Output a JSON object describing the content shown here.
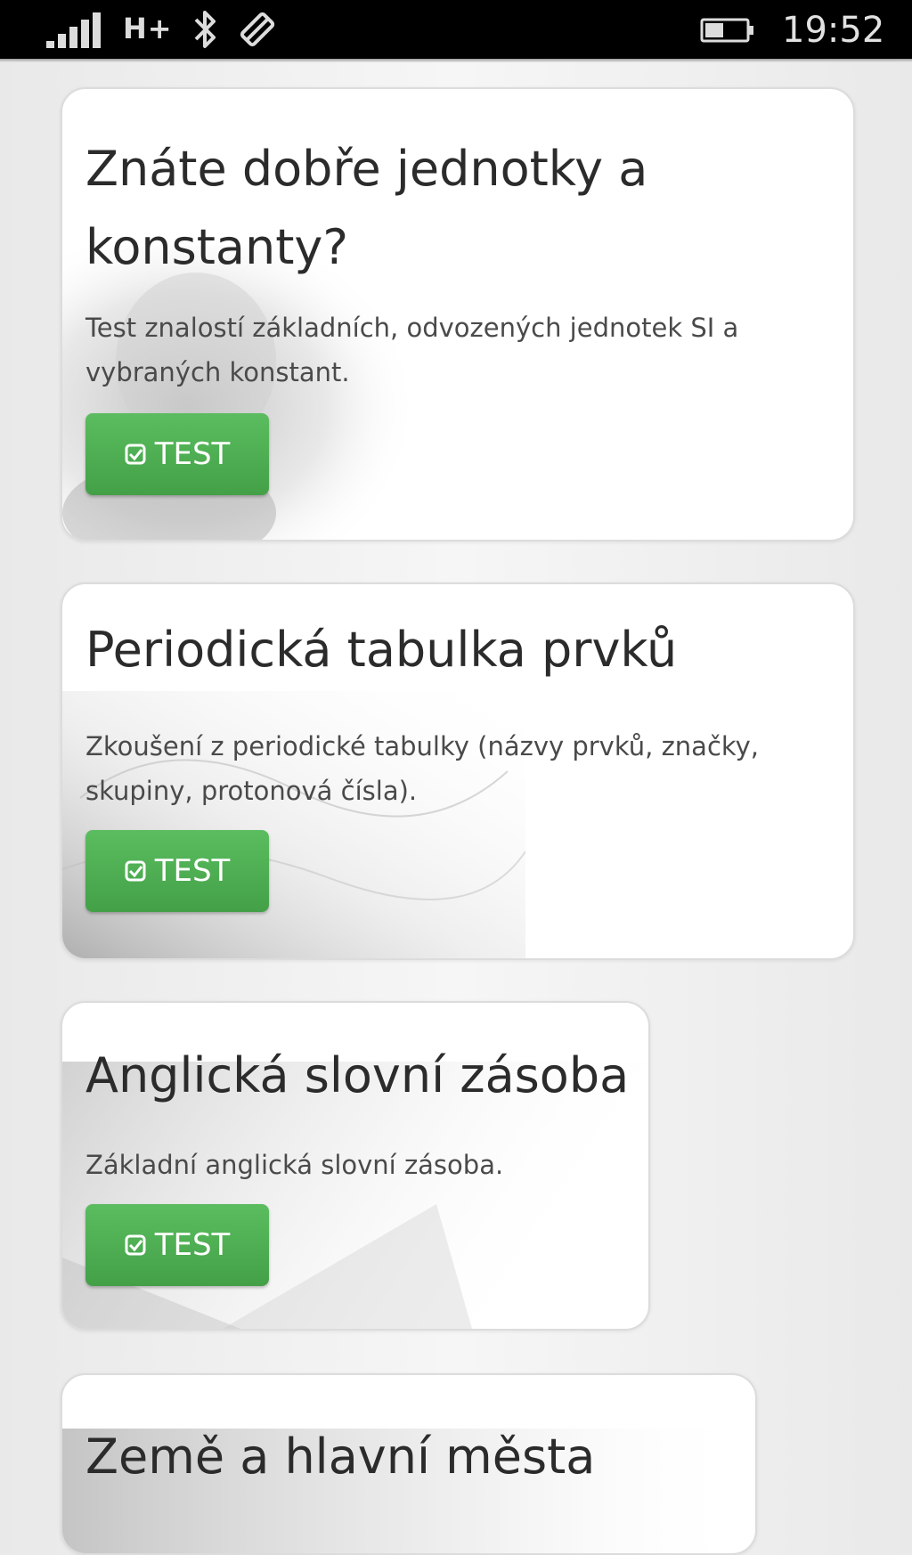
{
  "status_bar": {
    "network": "H+",
    "time": "19:52",
    "icons": [
      "signal-icon",
      "bluetooth-icon",
      "rotation-lock-icon",
      "battery-icon"
    ]
  },
  "colors": {
    "accent_green": "#4caf50",
    "card_bg": "#ffffff",
    "page_bg": "#efefef",
    "status_bar_bg": "#000000"
  },
  "cards": [
    {
      "title": "Znáte dobře jednotky a konstanty?",
      "description": "Test znalostí základních, odvozených jednotek SI a vybraných konstant.",
      "button_label": "TEST",
      "button_icon": "check-square-icon"
    },
    {
      "title": "Periodická tabulka prvků",
      "description": "Zkoušení z periodické tabulky (názvy prvků, značky, skupiny, protonová čísla).",
      "button_label": "TEST",
      "button_icon": "check-square-icon"
    },
    {
      "title": "Anglická slovní zásoba",
      "description": "Základní anglická slovní zásoba.",
      "button_label": "TEST",
      "button_icon": "check-square-icon"
    },
    {
      "title": "Země a hlavní města"
    }
  ]
}
